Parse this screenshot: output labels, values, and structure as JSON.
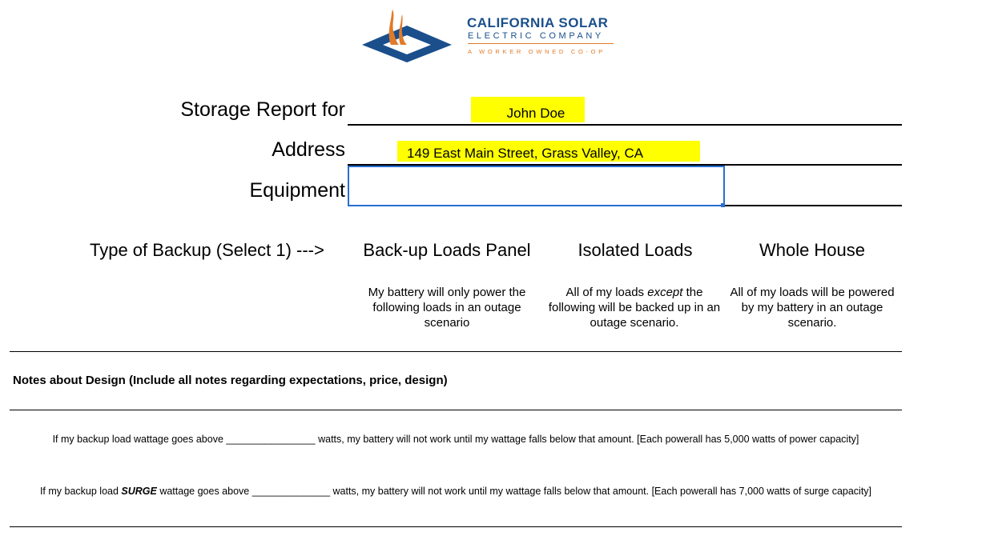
{
  "logo": {
    "name": "CALIFORNIA SOLAR",
    "sub": "ELECTRIC COMPANY",
    "tagline": "A WORKER OWNED CO-OP",
    "colors": {
      "blue": "#1a4f8c",
      "orange": "#e07b2a"
    }
  },
  "report": {
    "storage_label": "Storage Report for",
    "storage_value": "John Doe",
    "address_label": "Address",
    "address_value": "149 East Main Street, Grass Valley, CA",
    "equipment_label": "Equipment",
    "equipment_value": ""
  },
  "backup": {
    "label": "Type of Backup (Select 1) --->",
    "options": [
      {
        "title": "Back-up Loads Panel",
        "desc": "My battery will only power the following loads in an outage scenario"
      },
      {
        "title": "Isolated Loads",
        "desc_pre": "All of my loads ",
        "desc_em": "except",
        "desc_post": " the following will be backed up in an outage scenario."
      },
      {
        "title": "Whole House",
        "desc": "All of my loads will be powered by my battery in an outage scenario."
      }
    ]
  },
  "notes": {
    "heading": "Notes about Design (Include all notes regarding expectations, price, design)"
  },
  "clauses": {
    "wattage": "If my backup load wattage goes above ________________ watts, my battery will not work until my wattage falls below that amount. [Each powerall has 5,000 watts of power capacity]",
    "surge_pre": "If my backup load ",
    "surge_em": "SURGE",
    "surge_post": " wattage goes above ______________ watts, my battery will not work until my wattage falls below that amount. [Each powerall has 7,000 watts of surge capacity]"
  },
  "highlight_color": "#ffff00",
  "selection_color": "#2a6ed1"
}
